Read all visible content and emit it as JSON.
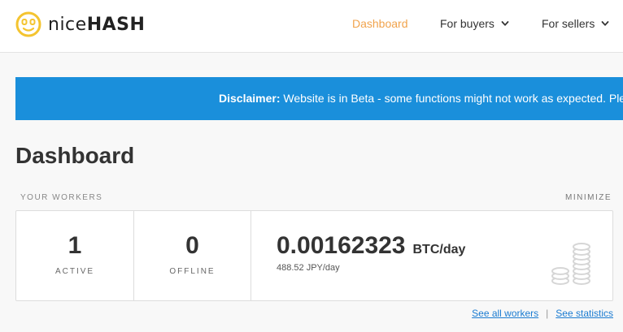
{
  "header": {
    "logo_text_a": "nice",
    "logo_text_b": "HASH",
    "nav": {
      "dashboard": "Dashboard",
      "for_buyers": "For buyers",
      "for_sellers": "For sellers"
    }
  },
  "banner": {
    "label": "Disclaimer:",
    "text": " Website is in Beta - some functions might not work as expected. Plea"
  },
  "page": {
    "title": "Dashboard"
  },
  "workers": {
    "section_label": "YOUR WORKERS",
    "minimize_label": "MINIMIZE",
    "active_count": "1",
    "active_label": "ACTIVE",
    "offline_count": "0",
    "offline_label": "OFFLINE",
    "profitability": "0.00162323",
    "profitability_unit": "BTC/day",
    "fiat_profitability": "488.52 JPY/day",
    "see_all_workers": "See all workers",
    "separator": "|",
    "see_statistics": "See statistics"
  },
  "colors": {
    "accent": "#f1a34c",
    "banner": "#1a8fdb",
    "link": "#1a7bd1"
  },
  "icons": [
    "nicehash-logo-icon",
    "chevron-down-icon",
    "coin-stack-icon"
  ]
}
